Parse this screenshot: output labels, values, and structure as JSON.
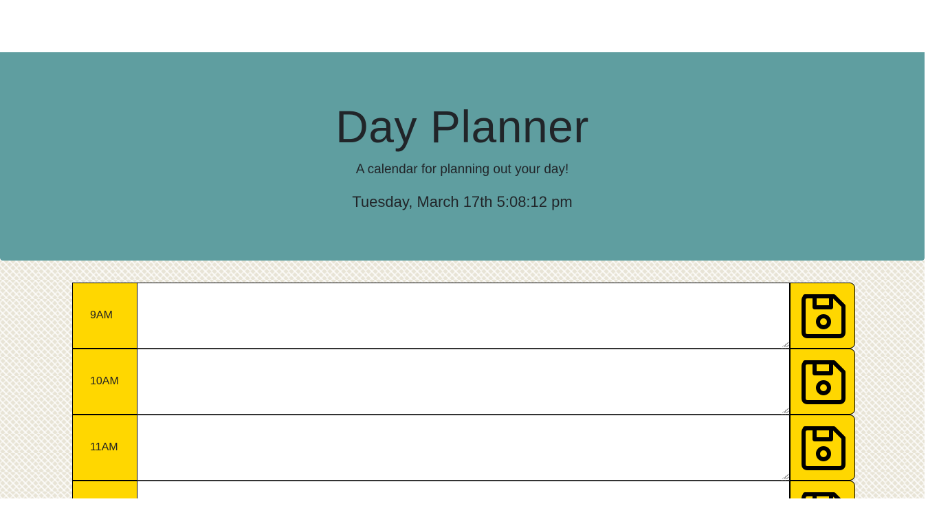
{
  "header": {
    "title": "Day Planner",
    "subtitle": "A calendar for planning out your day!",
    "current_day": "Tuesday, March 17th 5:08:12 pm"
  },
  "colors": {
    "jumbotron": "#5f9ea0",
    "hour_block": "#ffd700",
    "text": "#212529"
  },
  "icons": {
    "save": "save-floppy-disk-icon"
  },
  "time_blocks": [
    {
      "hour": "9AM",
      "description": ""
    },
    {
      "hour": "10AM",
      "description": ""
    },
    {
      "hour": "11AM",
      "description": ""
    },
    {
      "hour": "",
      "description": ""
    }
  ]
}
